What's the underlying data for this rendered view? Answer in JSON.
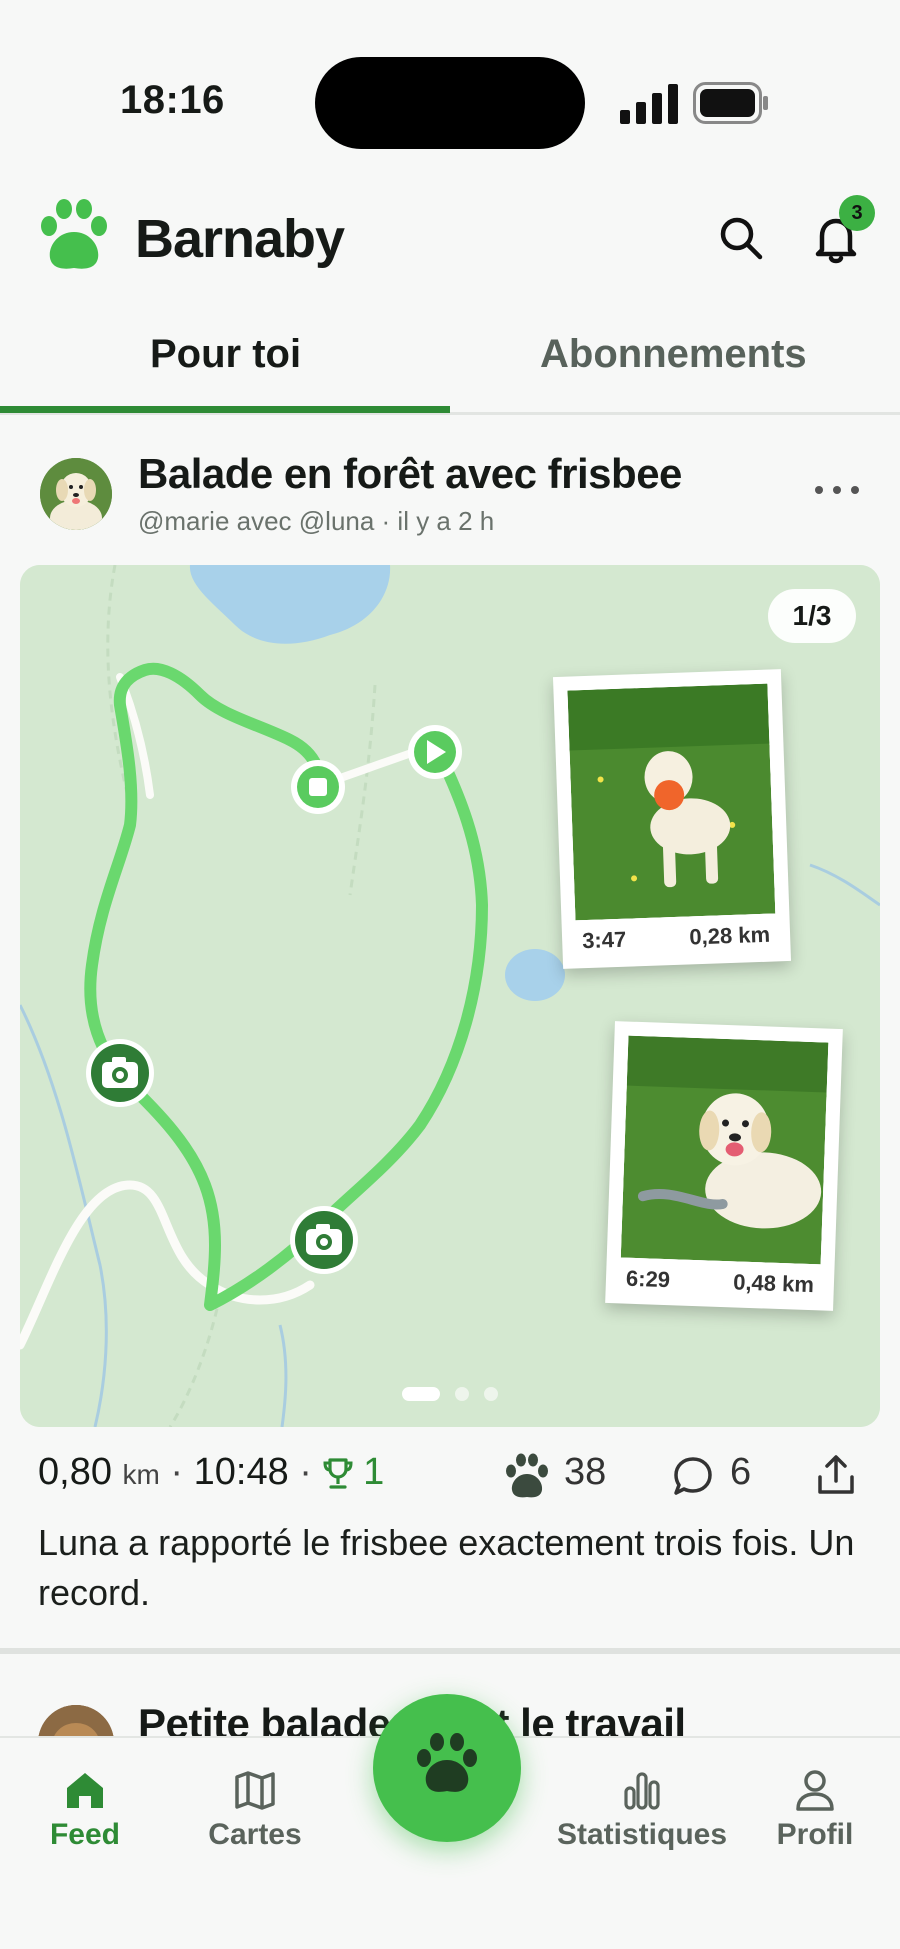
{
  "status_bar": {
    "time": "18:16"
  },
  "header": {
    "app_name": "Barnaby",
    "notification_count": "3"
  },
  "tabs": [
    {
      "label": "Pour toi",
      "active": true
    },
    {
      "label": "Abonnements",
      "active": false
    }
  ],
  "post": {
    "title": "Balade en forêt avec frisbee",
    "meta": "@marie avec @luna · il y a 2 h",
    "page_counter": "1/3",
    "photos": [
      {
        "time": "3:47",
        "distance": "0,28 km"
      },
      {
        "time": "6:29",
        "distance": "0,48 km"
      }
    ],
    "stats": {
      "distance_value": "0,80",
      "distance_unit": "km",
      "separator": "·",
      "duration": "10:48",
      "trophies": "1",
      "paws": "38",
      "comments": "6"
    },
    "text": "Luna a rapporté le frisbee exactement trois fois. Un record."
  },
  "next_post": {
    "title": "Petite balade avant le travail"
  },
  "nav": {
    "feed": "Feed",
    "maps": "Cartes",
    "stats": "Statistiques",
    "profile": "Profil"
  },
  "colors": {
    "accent": "#2e8b35",
    "route": "#6ad86e",
    "map_bg": "#d4e8d0",
    "fab": "#45bf4d"
  }
}
